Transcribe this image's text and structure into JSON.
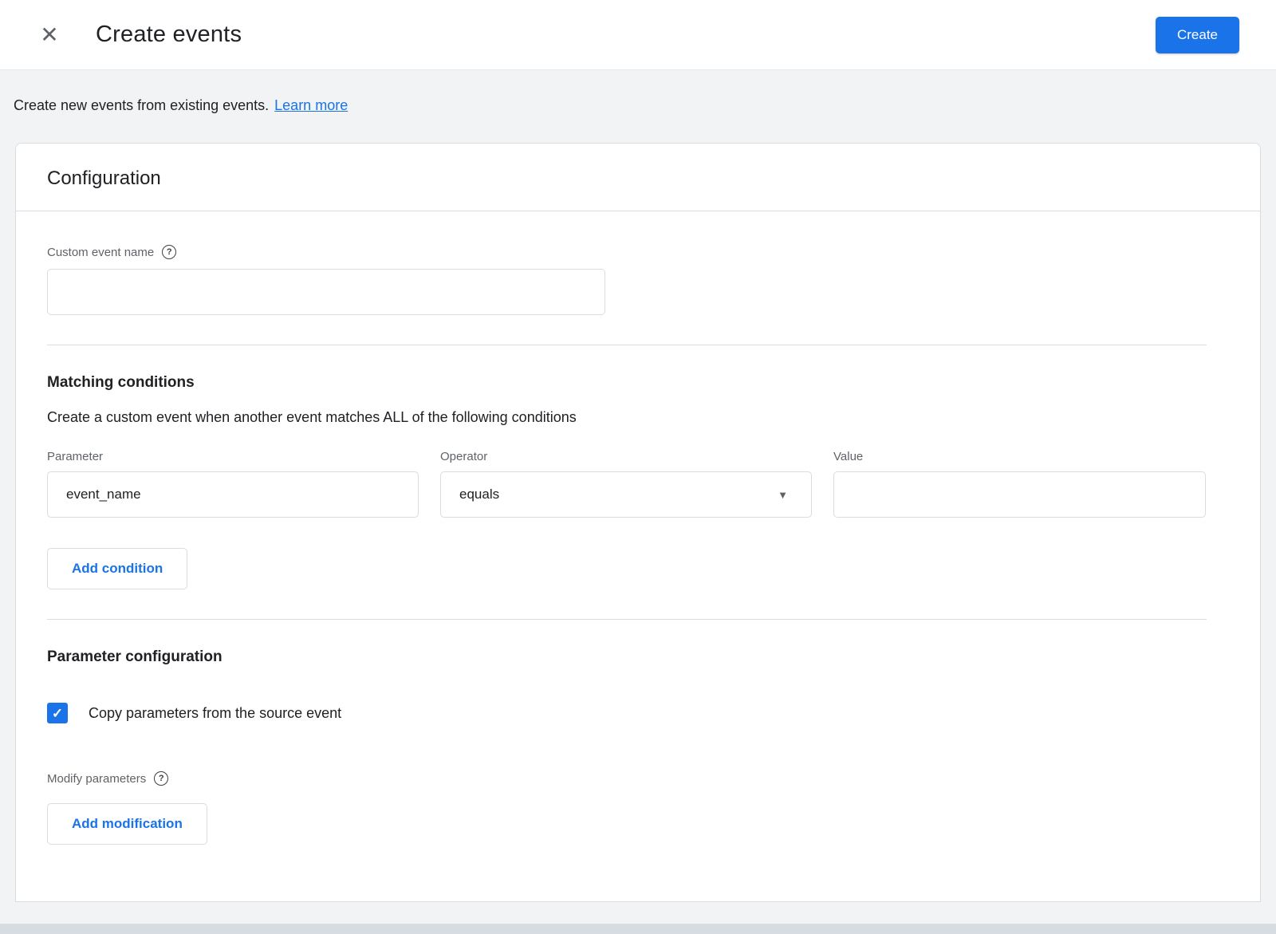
{
  "header": {
    "title": "Create events",
    "create_button": "Create"
  },
  "intro": {
    "text": "Create new events from existing events.",
    "link": "Learn more"
  },
  "card": {
    "title": "Configuration",
    "custom_event": {
      "label": "Custom event name",
      "value": ""
    },
    "matching": {
      "title": "Matching conditions",
      "description": "Create a custom event when another event matches ALL of the following conditions",
      "columns": {
        "parameter_label": "Parameter",
        "operator_label": "Operator",
        "value_label": "Value"
      },
      "condition": {
        "parameter": "event_name",
        "operator": "equals",
        "value": ""
      },
      "add_condition_button": "Add condition"
    },
    "parameter_config": {
      "title": "Parameter configuration",
      "copy_checkbox_label": "Copy parameters from the source event",
      "copy_checked": true,
      "modify_label": "Modify parameters",
      "add_modification_button": "Add modification"
    }
  },
  "icons": {
    "close": "✕",
    "help": "?",
    "caret": "▼",
    "check": "✓"
  },
  "colors": {
    "accent": "#1a73e8",
    "border": "#dadce0",
    "text": "#202124",
    "muted": "#5f6368",
    "background": "#f1f3f4"
  }
}
